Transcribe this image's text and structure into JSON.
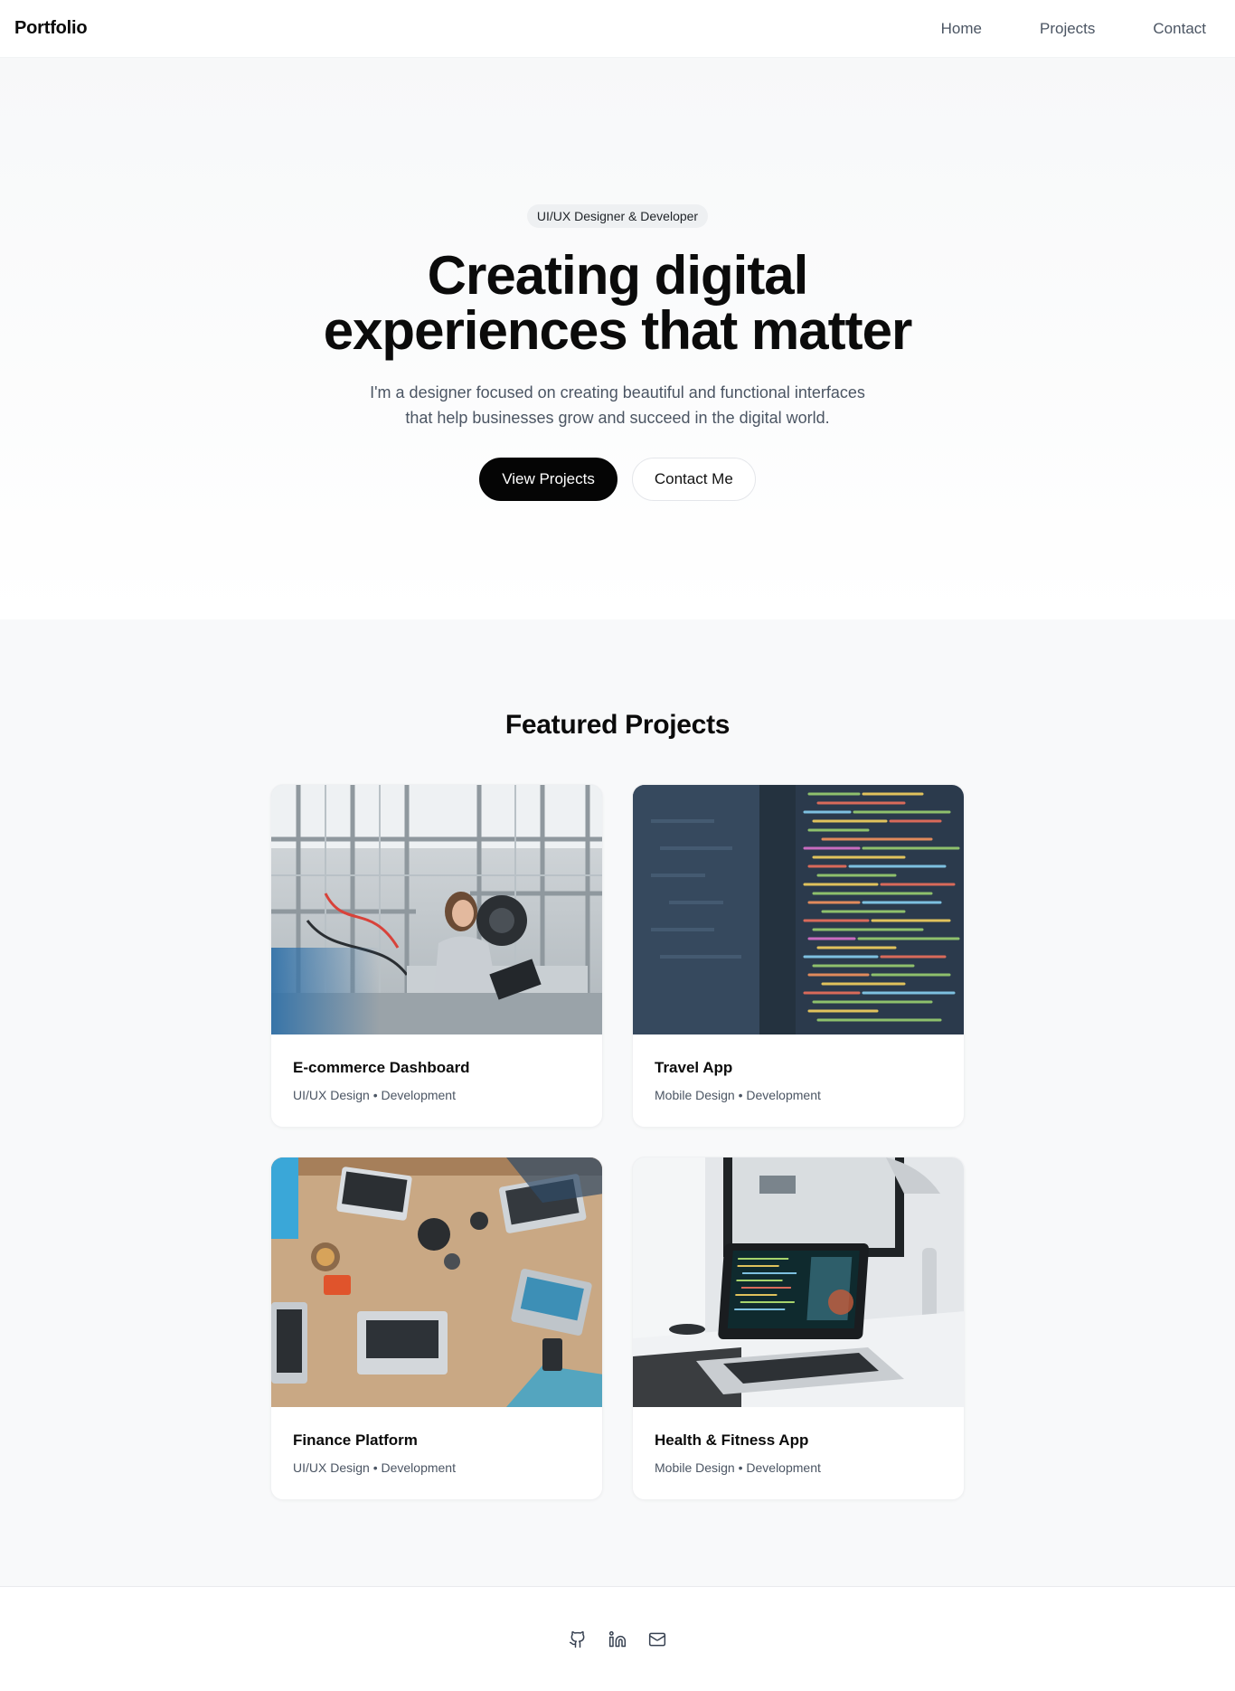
{
  "nav": {
    "brand": "Portfolio",
    "links": [
      {
        "label": "Home"
      },
      {
        "label": "Projects"
      },
      {
        "label": "Contact"
      }
    ]
  },
  "hero": {
    "badge": "UI/UX Designer & Developer",
    "title": "Creating digital experiences that matter",
    "subtitle": "I'm a designer focused on creating beautiful and functional interfaces that help businesses grow and succeed in the digital world.",
    "primary_button": "View Projects",
    "secondary_button": "Contact Me"
  },
  "projects": {
    "heading": "Featured Projects",
    "items": [
      {
        "title": "E-commerce Dashboard",
        "meta": "UI/UX Design • Development"
      },
      {
        "title": "Travel App",
        "meta": "Mobile Design • Development"
      },
      {
        "title": "Finance Platform",
        "meta": "UI/UX Design • Development"
      },
      {
        "title": "Health & Fitness App",
        "meta": "Mobile Design • Development"
      }
    ]
  },
  "footer": {
    "icons": [
      "github-icon",
      "linkedin-icon",
      "mail-icon"
    ]
  },
  "colors": {
    "primary": "#050505",
    "text_muted": "#4b5563",
    "section_bg": "#f8f9fa"
  }
}
